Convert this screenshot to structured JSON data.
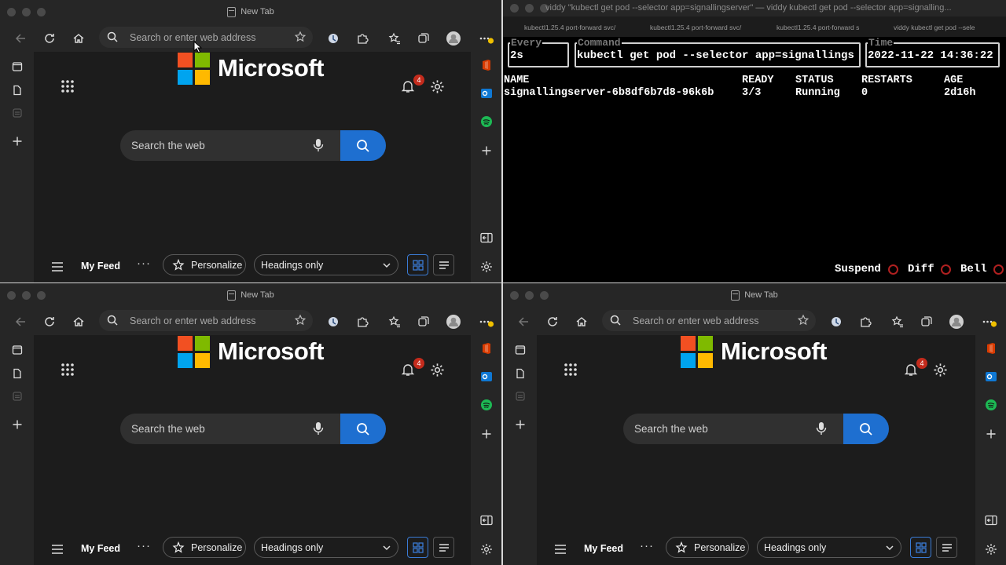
{
  "browser": {
    "tab_title": "New Tab",
    "address_placeholder": "Search or enter web address",
    "logo_text": "Microsoft",
    "notification_count": "4",
    "search_placeholder": "Search the web",
    "feed_label": "My Feed",
    "more_label": "···",
    "personalize_label": "Personalize",
    "headings_select": "Headings only",
    "colors": {
      "accent": "#1e6fd0",
      "ms_red": "#f25022",
      "ms_green": "#7fba00",
      "ms_blue": "#00a4ef",
      "ms_yellow": "#ffb900"
    }
  },
  "terminal": {
    "title": "viddy \"kubectl get pod --selector app=signallingserver\" — viddy kubectl get pod --selector app=signalling...",
    "tabs": [
      "kubectl1.25.4 port-forward svc/",
      "kubectl1.25.4 port-forward svc/",
      "kubectl1.25.4 port-forward s",
      "viddy kubectl get pod --sele"
    ],
    "every_label": "Every",
    "every_value": "2s",
    "command_label": "Command",
    "command_value": "kubectl get pod --selector app=signallings",
    "time_label": "Time",
    "time_value": "2022-11-22 14:36:22",
    "headers": [
      "NAME",
      "READY",
      "STATUS",
      "RESTARTS",
      "AGE"
    ],
    "row": [
      "signallingserver-6b8df6b7d8-96k6b",
      "3/3",
      "Running",
      "0",
      "2d16h"
    ],
    "footer": [
      "Suspend",
      "Diff",
      "Bell"
    ]
  }
}
